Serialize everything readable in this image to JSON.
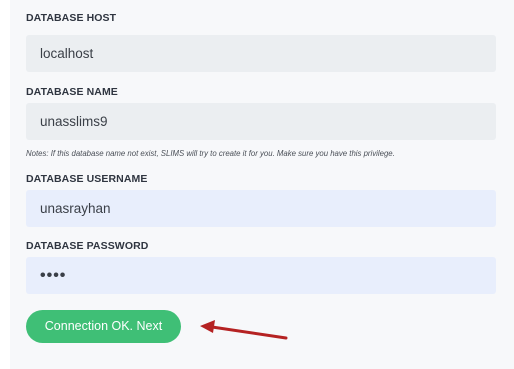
{
  "form": {
    "host_label": "DATABASE HOST",
    "host_value": "localhost",
    "name_label": "DATABASE NAME",
    "name_value": "unasslims9",
    "note": "Notes: If this database name not exist, SLIMS will try to create it for you. Make sure you have this privilege.",
    "username_label": "DATABASE USERNAME",
    "username_value": "unasrayhan",
    "password_label": "DATABASE PASSWORD",
    "password_value": "••••",
    "submit_label": "Connection OK. Next"
  },
  "colors": {
    "button": "#3fbf76",
    "arrow": "#b52222",
    "field_grey": "#ebeef1",
    "field_blue": "#e8eefc"
  },
  "icons": {
    "annotation": "red-arrow-icon"
  }
}
